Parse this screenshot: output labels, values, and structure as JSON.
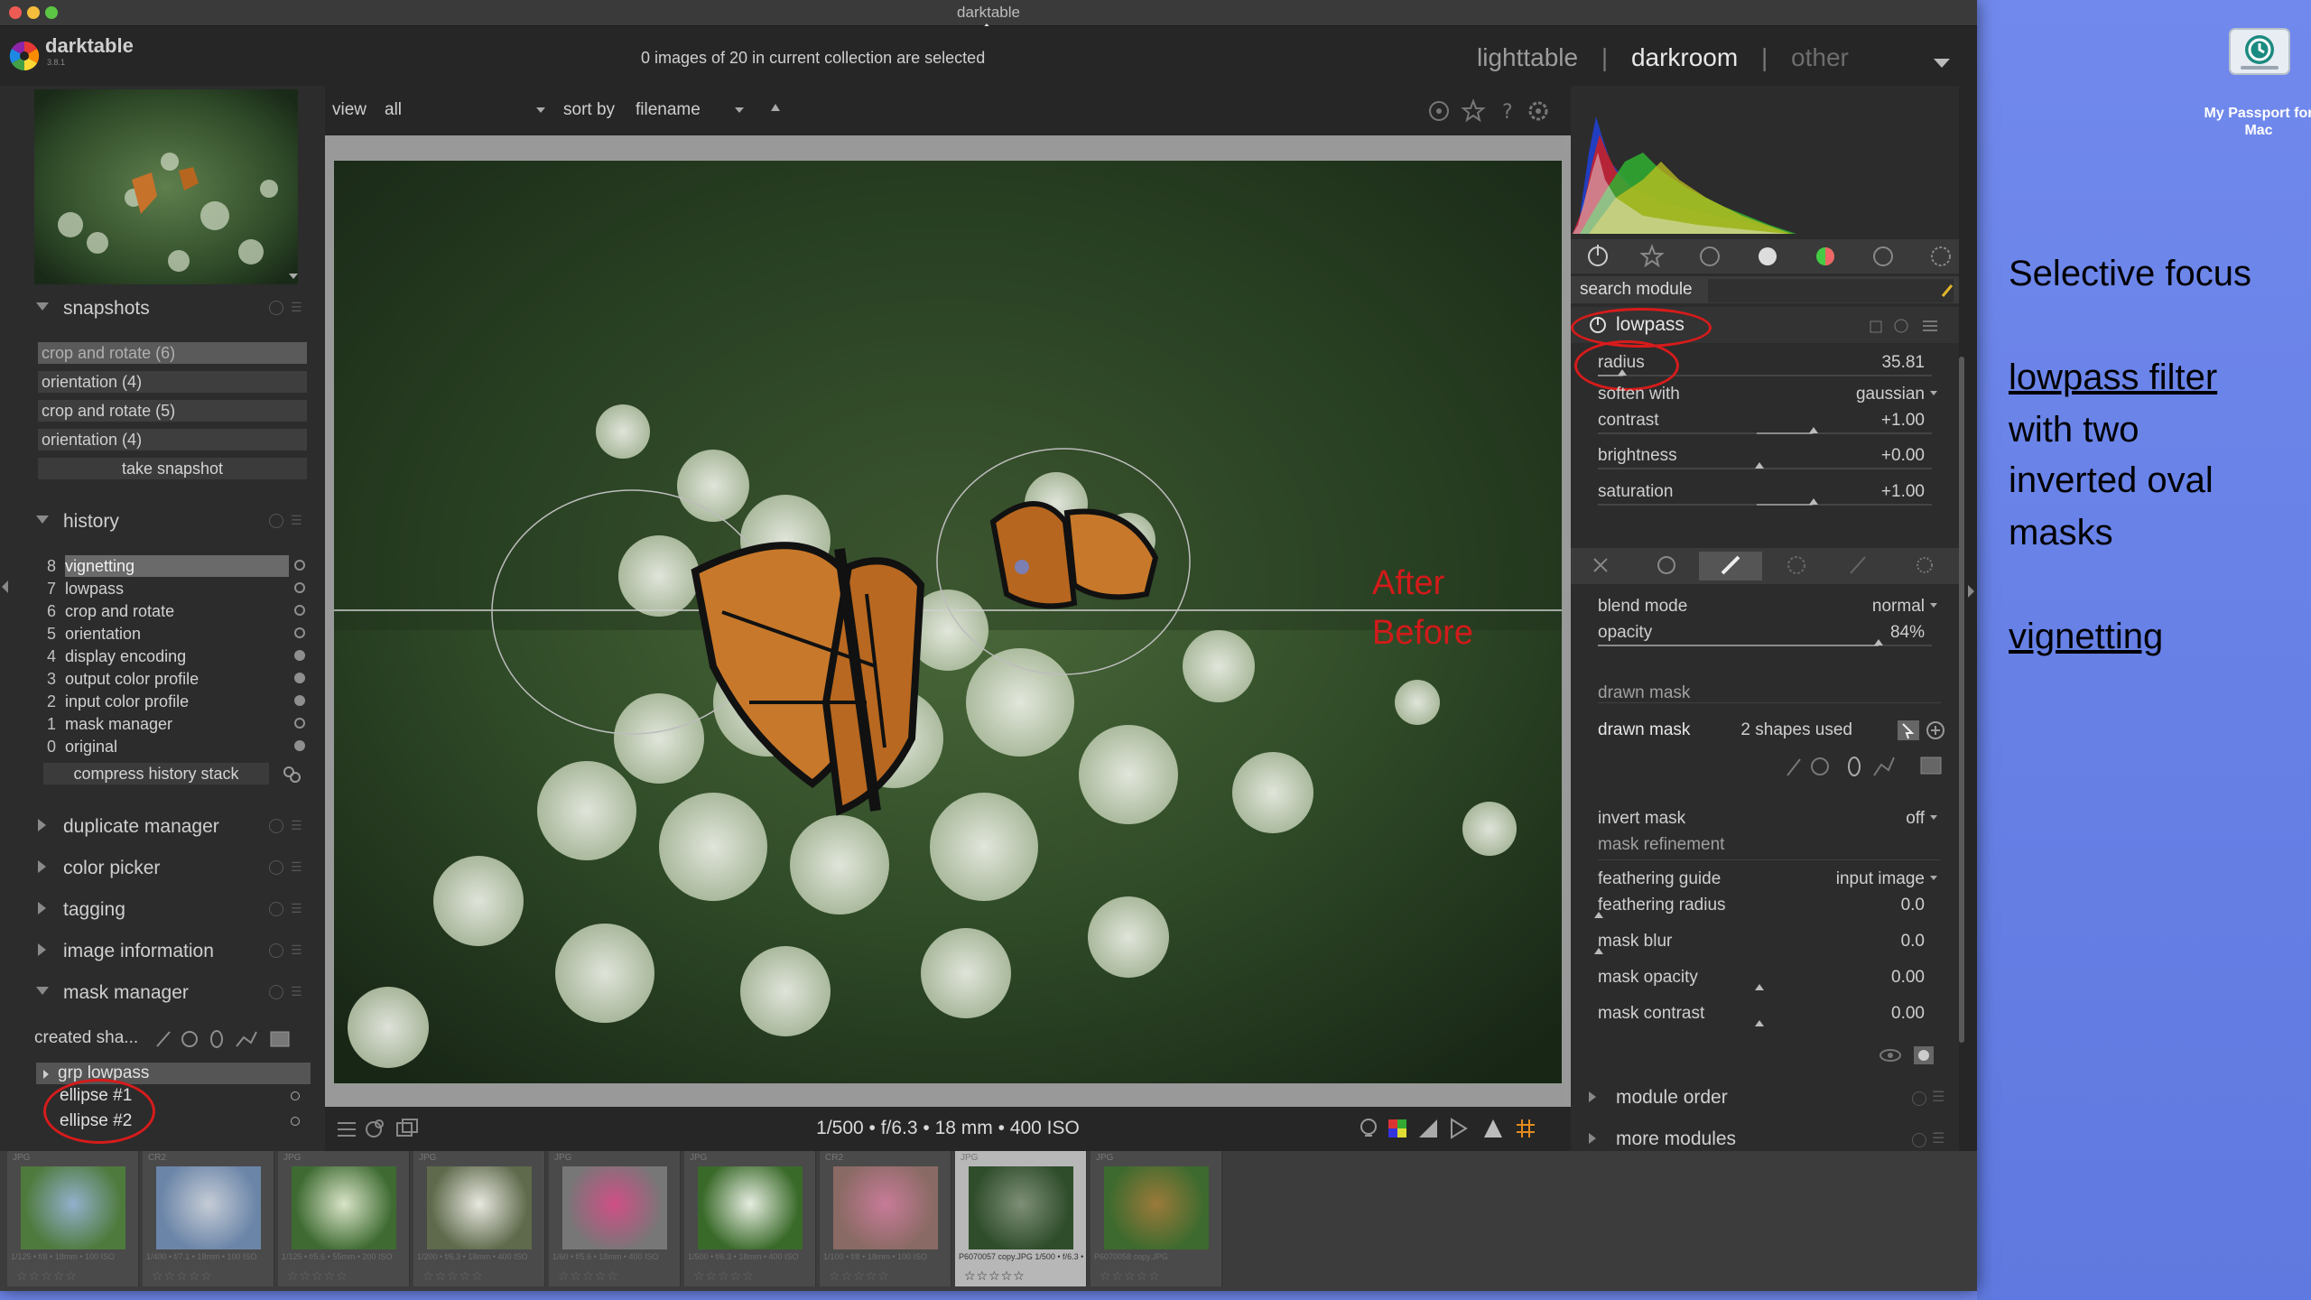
{
  "window": {
    "title": "darktable"
  },
  "header": {
    "app_name": "darktable",
    "app_version": "3.8.1",
    "selection_info": "0 images of 20 in current collection are selected",
    "views": [
      "lighttable",
      "darkroom",
      "other"
    ],
    "separator": "|",
    "active_view": "darkroom"
  },
  "toolbar": {
    "view_label": "view",
    "view_value": "all",
    "sort_label": "sort by",
    "sort_value": "filename"
  },
  "left_panel": {
    "snapshots": {
      "title": "snapshots",
      "items": [
        "crop and rotate (6)",
        "orientation (4)",
        "crop and rotate (5)",
        "orientation (4)"
      ],
      "take_button": "take snapshot"
    },
    "history": {
      "title": "history",
      "items": [
        {
          "n": "8",
          "label": "vignetting"
        },
        {
          "n": "7",
          "label": "lowpass"
        },
        {
          "n": "6",
          "label": "crop and rotate"
        },
        {
          "n": "5",
          "label": "orientation"
        },
        {
          "n": "4",
          "label": "display encoding"
        },
        {
          "n": "3",
          "label": "output color profile"
        },
        {
          "n": "2",
          "label": "input color profile"
        },
        {
          "n": "1",
          "label": "mask manager"
        },
        {
          "n": "0",
          "label": "original"
        }
      ],
      "compress_button": "compress history stack"
    },
    "sections": [
      "duplicate manager",
      "color picker",
      "tagging",
      "image information",
      "mask manager"
    ],
    "mask_manager": {
      "created_label": "created sha...",
      "group": "grp lowpass",
      "shapes": [
        "ellipse #1",
        "ellipse #2"
      ]
    }
  },
  "image": {
    "after_label": "After",
    "before_label": "Before",
    "exif": "1/500 • f/6.3 • 18 mm • 400 ISO"
  },
  "right_panel": {
    "search_label": "search module",
    "module_name": "lowpass",
    "params": {
      "radius": {
        "label": "radius",
        "value": "35.81"
      },
      "soften": {
        "label": "soften with",
        "value": "gaussian"
      },
      "contrast": {
        "label": "contrast",
        "value": "+1.00"
      },
      "brightness": {
        "label": "brightness",
        "value": "+0.00"
      },
      "saturation": {
        "label": "saturation",
        "value": "+1.00"
      }
    },
    "blend": {
      "blend_mode_label": "blend mode",
      "blend_mode_value": "normal",
      "opacity_label": "opacity",
      "opacity_value": "84%",
      "drawn_mask_header": "drawn mask",
      "drawn_mask_label": "drawn mask",
      "drawn_mask_value": "2 shapes used",
      "invert_label": "invert mask",
      "invert_value": "off",
      "refinement_header": "mask refinement",
      "feather_guide_label": "feathering guide",
      "feather_guide_value": "input image",
      "feather_radius_label": "feathering radius",
      "feather_radius_value": "0.0",
      "blur_label": "mask blur",
      "blur_value": "0.0",
      "mask_opacity_label": "mask opacity",
      "mask_opacity_value": "0.00",
      "mask_contrast_label": "mask contrast",
      "mask_contrast_value": "0.00"
    },
    "module_order": "module order",
    "more_modules": "more modules"
  },
  "filmstrip": [
    {
      "ext": "JPG",
      "caption": "1/125 • f/8 • 18mm • 100 ISO",
      "stars": "☆☆☆☆☆",
      "colors": [
        "#4f7a3d",
        "#93b0cc"
      ]
    },
    {
      "ext": "CR2",
      "caption": "1/400 • f/7.1 • 18mm • 100 ISO",
      "stars": "☆☆☆☆☆",
      "colors": [
        "#6b85a8",
        "#c5ccd6"
      ]
    },
    {
      "ext": "JPG",
      "caption": "1/125 • f/5.6 • 55mm • 200 ISO",
      "stars": "☆☆☆☆☆",
      "colors": [
        "#3f6b32",
        "#d9e4c8"
      ]
    },
    {
      "ext": "JPG",
      "caption": "1/200 • f/6.3 • 18mm • 400 ISO",
      "stars": "☆☆☆☆☆",
      "colors": [
        "#5e6a4b",
        "#e8e8e0"
      ]
    },
    {
      "ext": "JPG",
      "caption": "1/60 • f/5.6 • 18mm • 400 ISO",
      "stars": "☆☆☆☆☆",
      "colors": [
        "#777777",
        "#cf4f86"
      ]
    },
    {
      "ext": "JPG",
      "caption": "1/500 • f/6.3 • 18mm • 400 ISO",
      "stars": "☆☆☆☆☆",
      "colors": [
        "#3a6a2a",
        "#e6ede0"
      ]
    },
    {
      "ext": "CR2",
      "caption": "1/100 • f/8 • 18mm • 100 ISO",
      "stars": "☆☆☆☆☆",
      "colors": [
        "#8a6a64",
        "#c77b98"
      ]
    },
    {
      "ext": "JPG",
      "caption": "P6070057 copy.JPG 1/500 • f/6.3 • 18mm • 400 ISO",
      "stars": "☆☆☆☆☆",
      "colors": [
        "#2f4d2b",
        "#7e8f77"
      ]
    },
    {
      "ext": "JPG",
      "caption": "P6070058 copy.JPG",
      "stars": "☆☆☆☆☆",
      "colors": [
        "#3d6a2e",
        "#9a7a3a"
      ]
    }
  ],
  "desktop": {
    "drive_label": "My Passport for Mac"
  },
  "annotations": {
    "title": "Selective focus",
    "lowpass_link": "lowpass filter",
    "body_lines": [
      "with two",
      "inverted oval",
      "masks"
    ],
    "vignetting_link": "vignetting"
  },
  "colors": {
    "accent_red": "#d21a1a",
    "desktop_blue": "#6f86ea"
  }
}
